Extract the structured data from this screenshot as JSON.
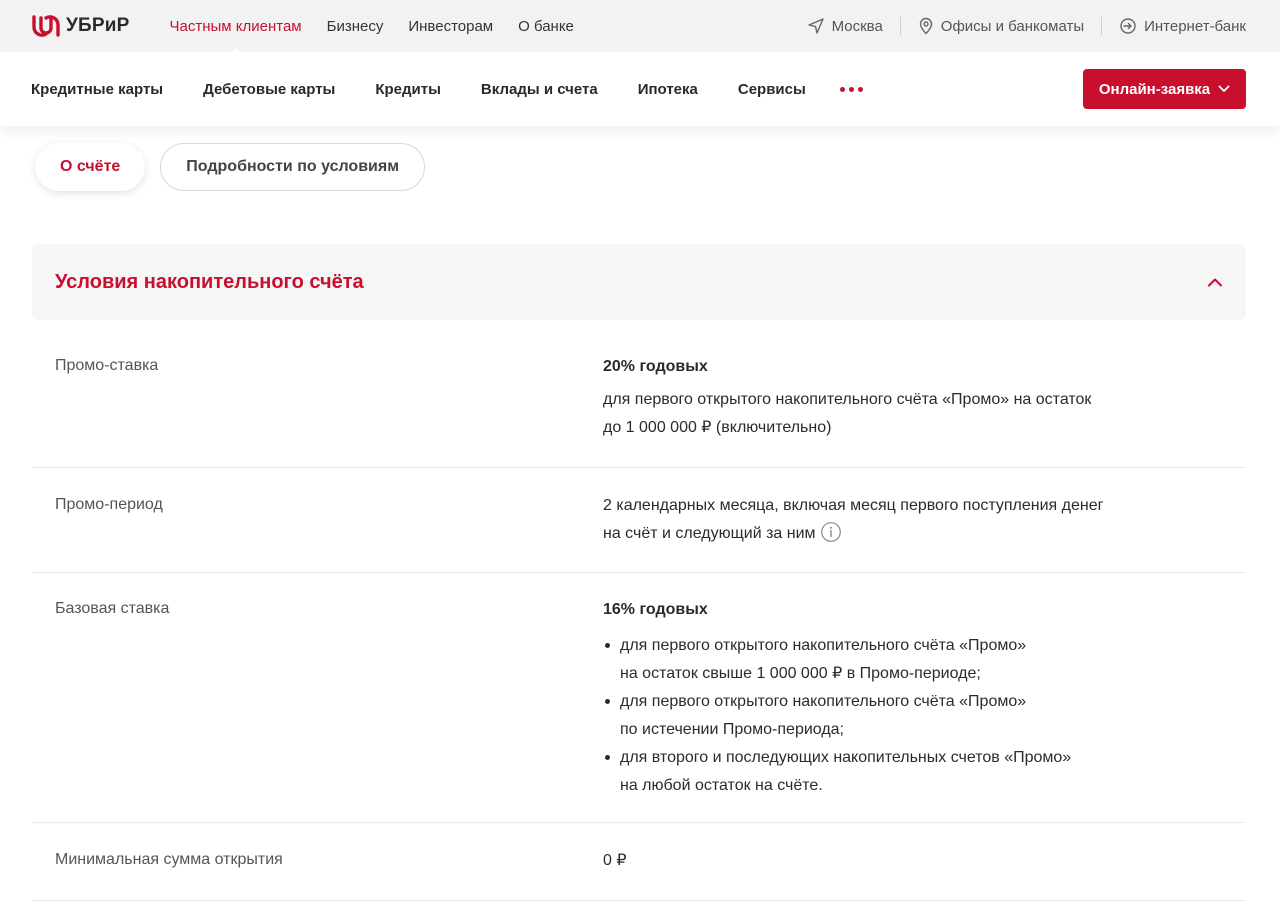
{
  "brand": {
    "name": "УБРиР",
    "accent": "#c8102e"
  },
  "topnav": {
    "items": [
      "Частным клиентам",
      "Бизнесу",
      "Инвесторам",
      "О банке"
    ],
    "active": "Частным клиентам",
    "city": "Москва",
    "offices": "Офисы и банкоматы",
    "internet_bank": "Интернет-банк"
  },
  "mainnav": {
    "items": [
      "Кредитные карты",
      "Дебетовые карты",
      "Кредиты",
      "Вклады и счета",
      "Ипотека",
      "Сервисы"
    ],
    "more_icon": "three-dots-icon",
    "apply_button": "Онлайн-заявка"
  },
  "tabs": [
    {
      "label": "О счёте",
      "active": true
    },
    {
      "label": "Подробности по условиям",
      "active": false
    }
  ],
  "accordion": {
    "title": "Условия накопительного счёта",
    "expanded": true,
    "rows": {
      "promo_rate": {
        "label": "Промо-ставка",
        "headline": "20% годовых",
        "desc_line1": "для первого открытого накопительного счёта «Промо» на остаток",
        "desc_line2": "до 1 000 000 ₽ (включительно)"
      },
      "promo_period": {
        "label": "Промо-период",
        "line1": "2 календарных месяца, включая месяц первого поступления денег",
        "line2": "на счёт и следующий за ним"
      },
      "base_rate": {
        "label": "Базовая ставка",
        "headline": "16% годовых",
        "bullets": [
          {
            "line1": "для первого открытого накопительного счёта «Промо»",
            "line2": "на остаток свыше 1 000 000 ₽ в Промо-периоде;"
          },
          {
            "line1": "для первого открытого накопительного счёта «Промо»",
            "line2": "по истечении Промо-периода;"
          },
          {
            "line1": "для второго и последующих накопительных счетов «Промо»",
            "line2": "на любой остаток на счёте."
          }
        ]
      },
      "min_amount": {
        "label": "Минимальная сумма открытия",
        "value": "0 ₽"
      }
    }
  }
}
